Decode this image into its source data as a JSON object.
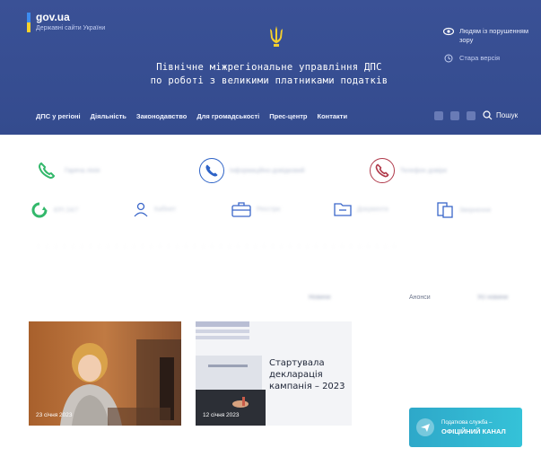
{
  "header": {
    "gov_logo": "gov.ua",
    "gov_sub": "Державні сайти України",
    "title_line1": "Північне міжрегіональне управління ДПС",
    "title_line2": "по роботі з великими платниками податків",
    "accessibility": "Людям із порушенням зору",
    "old_version": "Стара версія",
    "search_label": "Пошук",
    "nav": [
      "ДПС у регіоні",
      "Діяльність",
      "Законодавство",
      "Для громадськості",
      "Прес-центр",
      "Контакти"
    ]
  },
  "contacts": [
    {
      "label": "Гаряча лінія",
      "color": "#33b86b"
    },
    {
      "label": "Інформаційно-довідковий",
      "color": "#2e63c7"
    },
    {
      "label": "Телефон довіри",
      "color": "#b0394a"
    }
  ],
  "services": [
    {
      "label": "ЄРІ 24/7",
      "icon": "refresh-icon",
      "color": "#33b86b"
    },
    {
      "label": "Кабінет",
      "icon": "person-icon",
      "color": "#3a66c9"
    },
    {
      "label": "Реєстри",
      "icon": "briefcase-icon",
      "color": "#3a66c9"
    },
    {
      "label": "Документи",
      "icon": "folder-icon",
      "color": "#3a66c9"
    },
    {
      "label": "Звернення",
      "icon": "document-icon",
      "color": "#3a66c9"
    }
  ],
  "fine_line": "· · · · · · · · · · · · · · · · · · · · · · · · · · · · · · · · · · · · · · · · · ·",
  "tabs": [
    "Новини",
    "Анонси",
    "Усі новини"
  ],
  "news": [
    {
      "date": "23 січня 2023"
    },
    {
      "date": "12 січня 2023",
      "title": "Стартувала декларація кампанія – 2023"
    }
  ],
  "badge": {
    "top": "Податкова служба –",
    "main": "ОФІЦІЙНИЙ КАНАЛ"
  }
}
